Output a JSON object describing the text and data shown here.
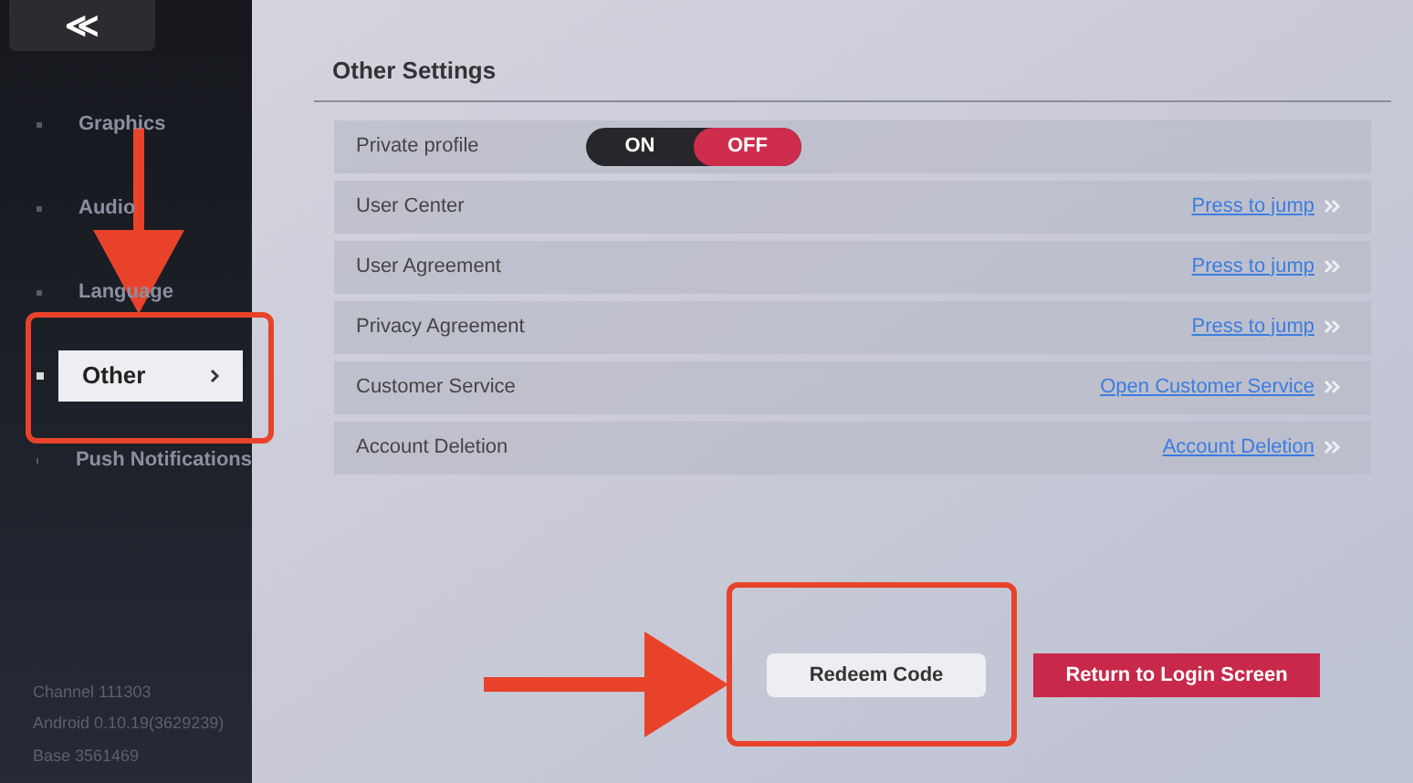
{
  "sidebar": {
    "back_button": "≪",
    "items": [
      {
        "label": "Graphics",
        "selected": false
      },
      {
        "label": "Audio",
        "selected": false
      },
      {
        "label": "Language",
        "selected": false
      },
      {
        "label": "Other",
        "selected": true
      },
      {
        "label": "Push Notifications",
        "selected": false
      }
    ],
    "version_info": [
      "Channel 111303",
      "Android 0.10.19(3629239)",
      "Base 3561469"
    ]
  },
  "section": {
    "title": "Other Settings",
    "rows": [
      {
        "kind": "toggle",
        "label": "Private profile",
        "options": [
          {
            "label": "ON",
            "selected": false
          },
          {
            "label": "OFF",
            "selected": true
          }
        ]
      },
      {
        "kind": "link",
        "label": "User Center",
        "link": "Press to jump"
      },
      {
        "kind": "link",
        "label": "User Agreement",
        "link": "Press to jump"
      },
      {
        "kind": "link",
        "label": "Privacy Agreement",
        "link": "Press to jump"
      },
      {
        "kind": "link",
        "label": "Customer Service",
        "link": "Open Customer Service"
      },
      {
        "kind": "link",
        "label": "Account Deletion",
        "link": "Account Deletion"
      }
    ]
  },
  "buttons": [
    {
      "kind": "secondary",
      "label": "Redeem Code"
    },
    {
      "kind": "primary",
      "label": "Return to Login Screen"
    }
  ]
}
